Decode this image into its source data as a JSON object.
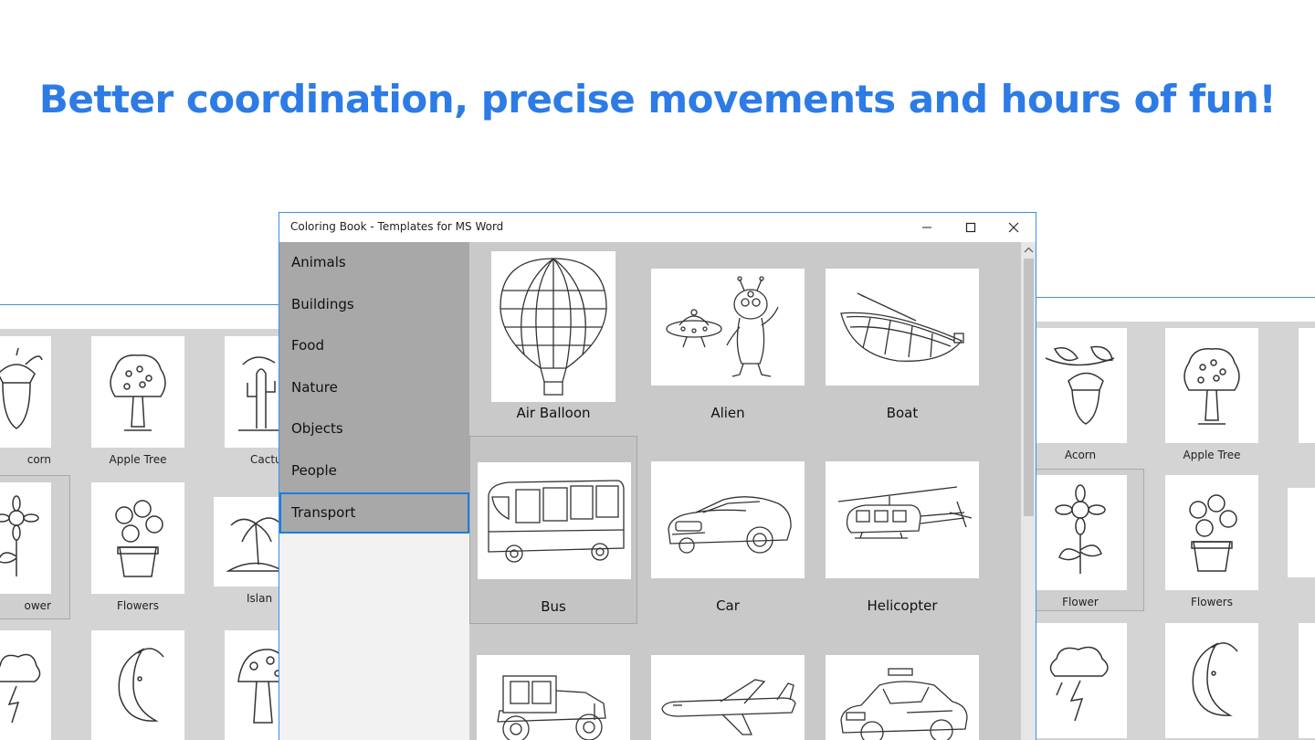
{
  "headline": "Better coordination, precise movements and hours of fun!",
  "window": {
    "title": "Coloring Book - Templates for MS Word",
    "categories": [
      "Animals",
      "Buildings",
      "Food",
      "Nature",
      "Objects",
      "People",
      "Transport"
    ],
    "active_category": "Transport",
    "items": [
      {
        "label": "Air Balloon",
        "icon": "air-balloon-icon"
      },
      {
        "label": "Alien",
        "icon": "alien-icon"
      },
      {
        "label": "Boat",
        "icon": "boat-icon"
      },
      {
        "label": "Bus",
        "icon": "bus-icon"
      },
      {
        "label": "Car",
        "icon": "car-icon"
      },
      {
        "label": "Helicopter",
        "icon": "helicopter-icon"
      },
      {
        "label": "",
        "icon": "vintage-car-icon"
      },
      {
        "label": "",
        "icon": "airplane-icon"
      },
      {
        "label": "",
        "icon": "police-car-icon"
      }
    ]
  },
  "bg_left": {
    "labels": [
      "corn",
      "Apple Tree",
      "Cactu",
      "ower",
      "Flowers",
      "Islan"
    ]
  },
  "bg_right": {
    "labels": [
      "Acorn",
      "Apple Tree",
      "Flower",
      "Flowers"
    ]
  },
  "colors": {
    "headline": "#2d7be5",
    "accent": "#1a7fe0",
    "category_bg": "#a8a8a8",
    "content_bg": "#c9c9c9"
  }
}
